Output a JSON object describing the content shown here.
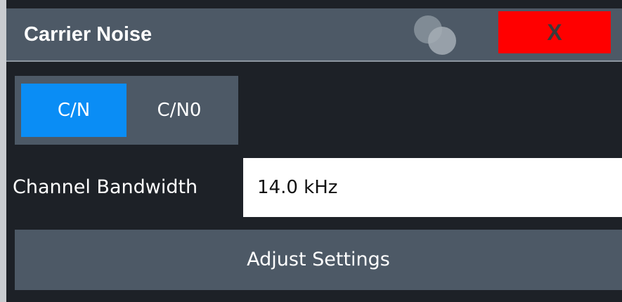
{
  "dialog": {
    "title": "Carrier Noise",
    "close_label": "X"
  },
  "mode_toggle": {
    "options": [
      {
        "label": "C/N",
        "selected": true
      },
      {
        "label": "C/N0",
        "selected": false
      }
    ]
  },
  "channel_bandwidth": {
    "label": "Channel Bandwidth",
    "value": "14.0 kHz"
  },
  "actions": {
    "adjust_settings_label": "Adjust Settings"
  },
  "colors": {
    "titlebar": "#4d5966",
    "active_toggle": "#0a8df5",
    "close_button": "#ff0000",
    "background": "#1d2127"
  },
  "icons": {
    "logo": "overlapping-circles-logo",
    "close": "close-icon"
  }
}
